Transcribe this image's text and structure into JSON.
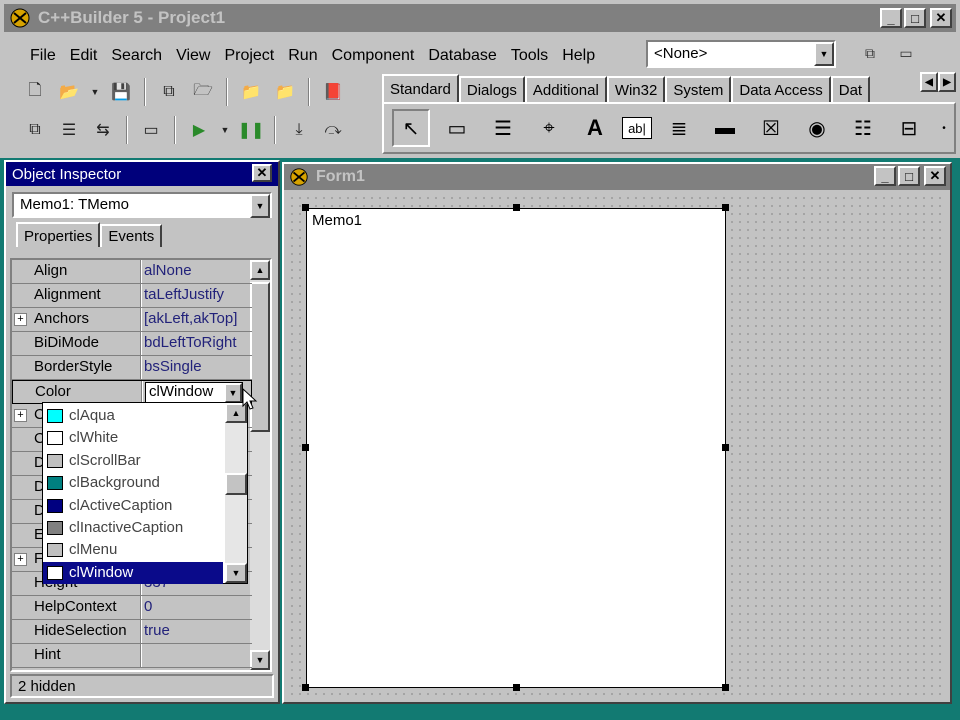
{
  "ide": {
    "title": "C++Builder 5 - Project1",
    "menu": [
      "File",
      "Edit",
      "Search",
      "View",
      "Project",
      "Run",
      "Component",
      "Database",
      "Tools",
      "Help"
    ],
    "config_combo": "<None>"
  },
  "palette": {
    "tabs": [
      "Standard",
      "Dialogs",
      "Additional",
      "Win32",
      "System",
      "Data Access",
      "Dat"
    ],
    "active_tab": "Standard",
    "components": [
      "pointer-icon",
      "frame-icon",
      "mainmenu-icon",
      "popupmenu-icon",
      "label-icon",
      "edit-icon",
      "memo-icon",
      "button-icon",
      "checkbox-icon",
      "radiobutton-icon",
      "listbox-icon",
      "combobox-icon"
    ],
    "label_glyph": "A",
    "edit_glyph": "ab|"
  },
  "inspector": {
    "title": "Object Inspector",
    "object": "Memo1: TMemo",
    "tabs": [
      "Properties",
      "Events"
    ],
    "properties": [
      {
        "name": "Align",
        "value": "alNone",
        "expandable": false
      },
      {
        "name": "Alignment",
        "value": "taLeftJustify",
        "expandable": false
      },
      {
        "name": "Anchors",
        "value": "[akLeft,akTop]",
        "expandable": true
      },
      {
        "name": "BiDiMode",
        "value": "bdLeftToRight",
        "expandable": false
      },
      {
        "name": "BorderStyle",
        "value": "bsSingle",
        "expandable": false
      },
      {
        "name": "Color",
        "value": "clWindow",
        "expandable": false,
        "editing": true
      },
      {
        "name": "C",
        "value": "",
        "expandable": true
      },
      {
        "name": "C",
        "value": "",
        "expandable": false
      },
      {
        "name": "D",
        "value": "",
        "expandable": false
      },
      {
        "name": "D",
        "value": "",
        "expandable": false
      },
      {
        "name": "D",
        "value": "",
        "expandable": false
      },
      {
        "name": "E",
        "value": "",
        "expandable": false
      },
      {
        "name": "F",
        "value": "",
        "expandable": true
      },
      {
        "name": "Height",
        "value": "337",
        "expandable": false
      },
      {
        "name": "HelpContext",
        "value": "0",
        "expandable": false
      },
      {
        "name": "HideSelection",
        "value": "true",
        "expandable": false
      },
      {
        "name": "Hint",
        "value": "",
        "expandable": false
      }
    ],
    "status": "2 hidden"
  },
  "color_dropdown": {
    "items": [
      {
        "label": "clAqua",
        "swatch": "#00ffff"
      },
      {
        "label": "clWhite",
        "swatch": "#ffffff"
      },
      {
        "label": "clScrollBar",
        "swatch": "#c0c0c0"
      },
      {
        "label": "clBackground",
        "swatch": "#008080"
      },
      {
        "label": "clActiveCaption",
        "swatch": "#000080"
      },
      {
        "label": "clInactiveCaption",
        "swatch": "#808080"
      },
      {
        "label": "clMenu",
        "swatch": "#c0c0c0"
      },
      {
        "label": "clWindow",
        "swatch": "#ffffff",
        "selected": true
      }
    ]
  },
  "form": {
    "title": "Form1",
    "memo_text": "Memo1"
  },
  "colors": {
    "desktop": "#127a72",
    "face": "#c3c3c3",
    "active_caption": "#00007b",
    "inactive_caption": "#808080"
  }
}
